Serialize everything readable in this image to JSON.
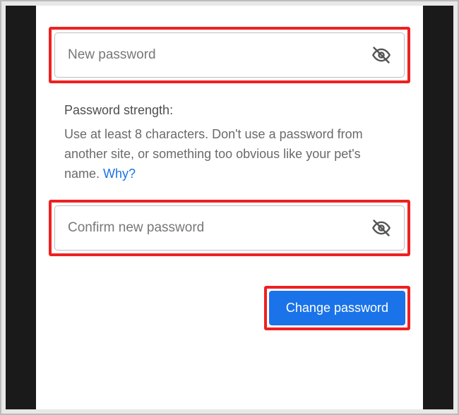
{
  "form": {
    "new_password": {
      "placeholder": "New password",
      "value": ""
    },
    "confirm_password": {
      "placeholder": "Confirm new password",
      "value": ""
    },
    "strength": {
      "title": "Password strength:",
      "description": "Use at least 8 characters. Don't use a password from another site, or something too obvious like your pet's name. ",
      "why_link": "Why?"
    },
    "submit_label": "Change password"
  },
  "icons": {
    "toggle_visibility": "eye-off-icon"
  },
  "colors": {
    "highlight": "#ef2020",
    "primary_button": "#1a73e8",
    "link": "#1a73e8"
  }
}
